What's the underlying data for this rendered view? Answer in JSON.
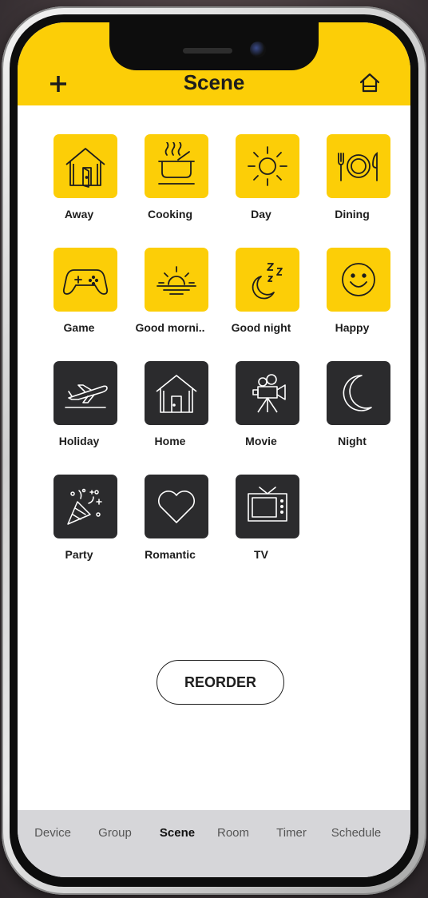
{
  "header": {
    "title": "Scene",
    "accent_color": "#fcce07",
    "add_icon": "plus-icon",
    "home_icon": "home-icon"
  },
  "scenes": [
    {
      "label": "Away",
      "icon": "away-house-icon",
      "style": "yellow"
    },
    {
      "label": "Cooking",
      "icon": "cooking-pot-icon",
      "style": "yellow"
    },
    {
      "label": "Day",
      "icon": "sun-icon",
      "style": "yellow"
    },
    {
      "label": "Dining",
      "icon": "plate-cutlery-icon",
      "style": "yellow"
    },
    {
      "label": "Game",
      "icon": "gamepad-icon",
      "style": "yellow"
    },
    {
      "label": "Good morni..",
      "icon": "sunrise-icon",
      "style": "yellow"
    },
    {
      "label": "Good night",
      "icon": "moon-zzz-icon",
      "style": "yellow"
    },
    {
      "label": "Happy",
      "icon": "smiley-icon",
      "style": "yellow"
    },
    {
      "label": "Holiday",
      "icon": "airplane-icon",
      "style": "dark"
    },
    {
      "label": "Home",
      "icon": "home-door-icon",
      "style": "dark"
    },
    {
      "label": "Movie",
      "icon": "movie-camera-icon",
      "style": "dark"
    },
    {
      "label": "Night",
      "icon": "crescent-moon-icon",
      "style": "dark"
    },
    {
      "label": "Party",
      "icon": "party-popper-icon",
      "style": "dark"
    },
    {
      "label": "Romantic",
      "icon": "heart-icon",
      "style": "dark"
    },
    {
      "label": "TV",
      "icon": "tv-icon",
      "style": "dark"
    }
  ],
  "actions": {
    "reorder_label": "REORDER"
  },
  "tabbar": {
    "tabs": [
      "Device",
      "Group",
      "Scene",
      "Room",
      "Timer",
      "Schedule"
    ],
    "active": "Scene"
  }
}
